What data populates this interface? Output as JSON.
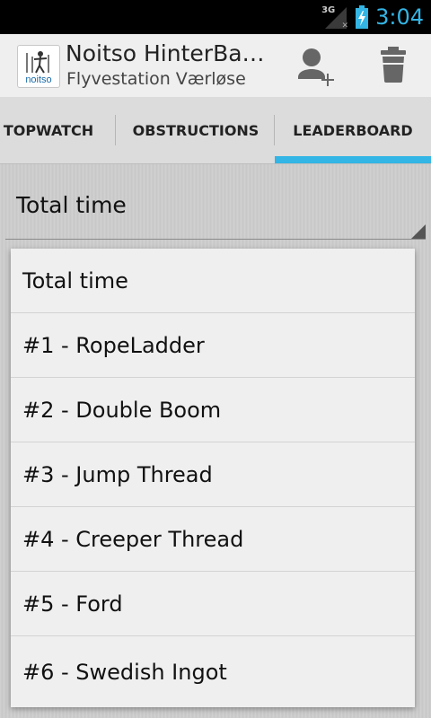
{
  "status_bar": {
    "network": "3G",
    "time": "3:04"
  },
  "action_bar": {
    "logo_text": "noitso",
    "title": "Noitso HinterBa…",
    "subtitle": "Flyvestation Værløse",
    "add_user_icon": "add-user-icon",
    "delete_icon": "trash-icon"
  },
  "tabs": [
    {
      "label": "TOPWATCH"
    },
    {
      "label": "OBSTRUCTIONS"
    },
    {
      "label": "LEADERBOARD",
      "selected": true
    }
  ],
  "accent_color": "#33b5e5",
  "spinner": {
    "selected": "Total time"
  },
  "dropdown": {
    "options": [
      "Total time",
      "#1 - RopeLadder",
      "#2 - Double Boom",
      "#3 - Jump Thread",
      "#4 - Creeper Thread",
      "#5 - Ford",
      "#6 - Swedish Ingot"
    ]
  }
}
